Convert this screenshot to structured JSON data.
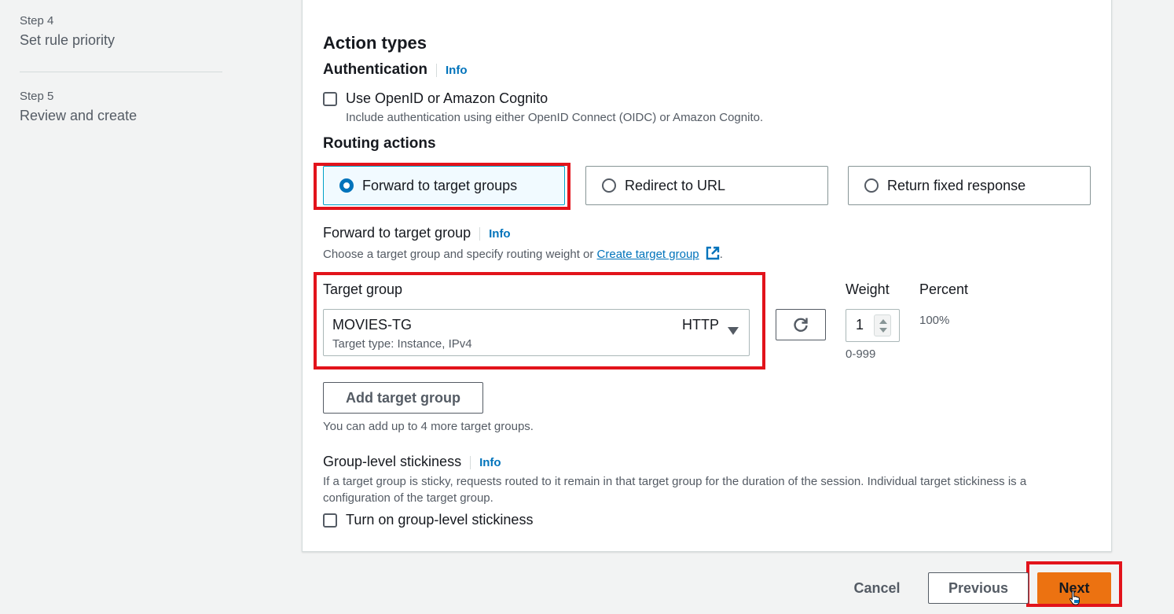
{
  "steps": [
    {
      "number": "Step 4",
      "title": "Set rule priority"
    },
    {
      "number": "Step 5",
      "title": "Review and create"
    }
  ],
  "action_types": {
    "heading": "Action types",
    "authentication": {
      "heading": "Authentication",
      "info": "Info",
      "checkbox_label": "Use OpenID or Amazon Cognito",
      "checkbox_checked": false,
      "description": "Include authentication using either OpenID Connect (OIDC) or Amazon Cognito."
    },
    "routing": {
      "heading": "Routing actions",
      "options": [
        {
          "label": "Forward to target groups",
          "selected": true
        },
        {
          "label": "Redirect to URL",
          "selected": false
        },
        {
          "label": "Return fixed response",
          "selected": false
        }
      ]
    },
    "forward": {
      "heading": "Forward to target group",
      "info": "Info",
      "description_prefix": "Choose a target group and specify routing weight or ",
      "create_link": "Create target group",
      "description_suffix": ".",
      "target_group_label": "Target group",
      "weight_label": "Weight",
      "percent_label": "Percent",
      "selected_group": {
        "name": "MOVIES-TG",
        "protocol": "HTTP",
        "subtitle": "Target type: Instance, IPv4"
      },
      "weight_value": "1",
      "weight_hint": "0-999",
      "percent_value": "100%",
      "add_button": "Add target group",
      "add_hint": "You can add up to 4 more target groups."
    },
    "stickiness": {
      "heading": "Group-level stickiness",
      "info": "Info",
      "description": "If a target group is sticky, requests routed to it remain in that target group for the duration of the session. Individual target stickiness is a configuration of the target group.",
      "checkbox_label": "Turn on group-level stickiness",
      "checkbox_checked": false
    }
  },
  "footer": {
    "cancel": "Cancel",
    "previous": "Previous",
    "next": "Next"
  },
  "colors": {
    "accent": "#0073bb",
    "primary_button": "#ec7211",
    "highlight_box": "#e2131b"
  },
  "icons": {
    "refresh": "refresh-icon",
    "external_link": "external-link-icon",
    "dropdown": "caret-down-icon",
    "cursor": "hand-pointer-icon"
  }
}
